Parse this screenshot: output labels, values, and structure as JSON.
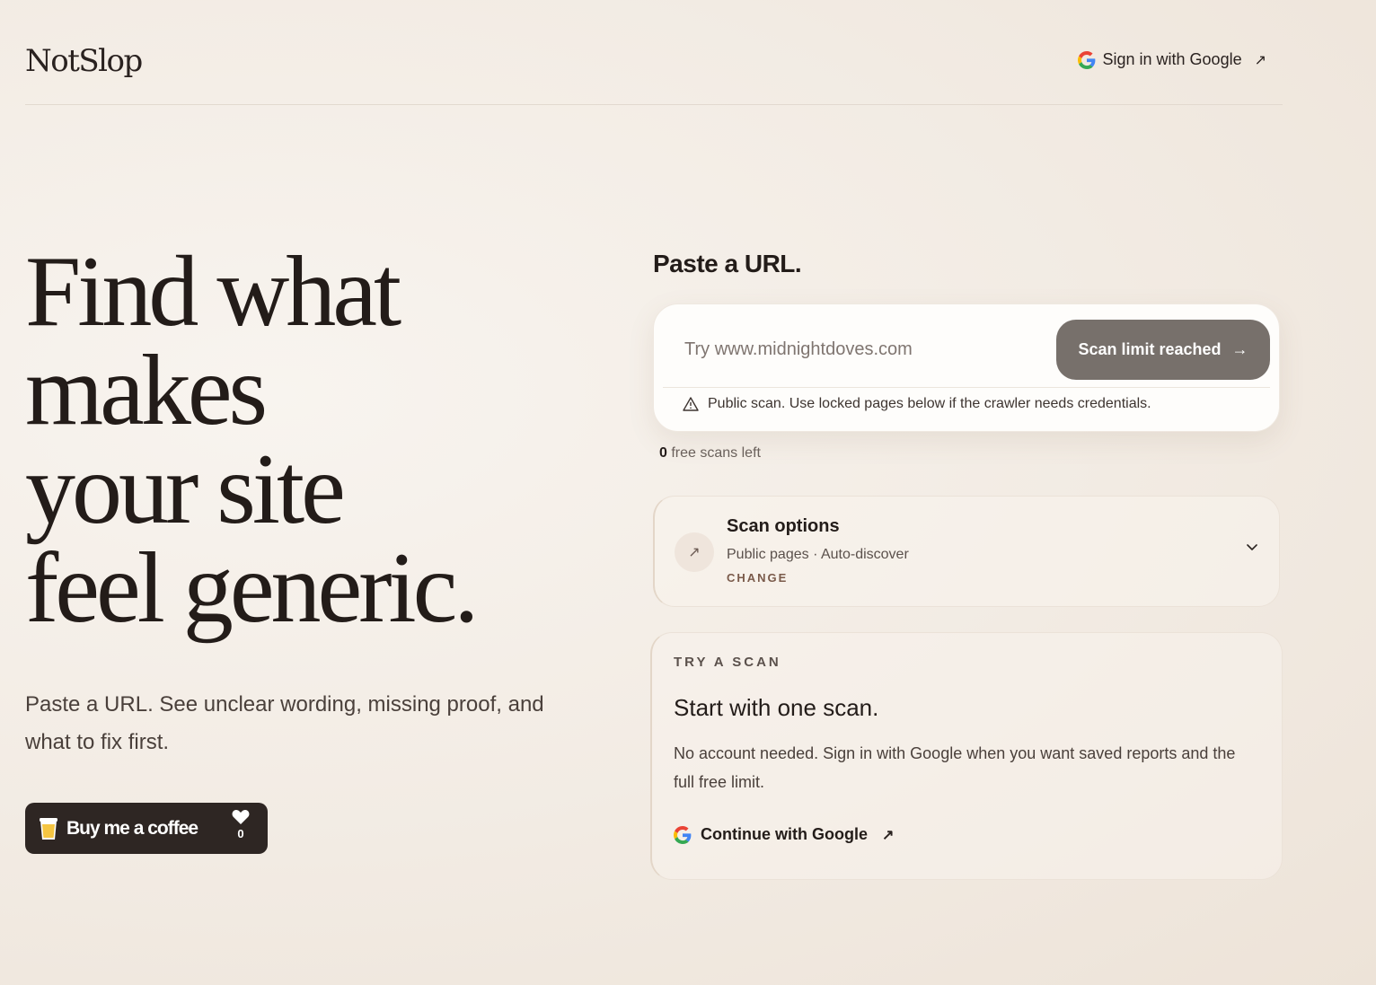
{
  "header": {
    "logo": "NotSlop",
    "signin_label": "Sign in with Google"
  },
  "hero": {
    "title_line1": "Find what",
    "title_line2": "makes",
    "title_line3": "your site",
    "title_line4": "feel generic.",
    "subtitle": "Paste a URL. See unclear wording, missing proof, and what to fix first."
  },
  "coffee": {
    "label": "Buy me a coffee",
    "count": "0"
  },
  "scan": {
    "title": "Paste a URL.",
    "placeholder": "Try www.midnightdoves.com",
    "button_label": "Scan limit reached",
    "note": "Public scan. Use locked pages below if the crawler needs credentials.",
    "free_count": "0",
    "free_label": "free scans left"
  },
  "options": {
    "title": "Scan options",
    "summary": "Public pages · Auto-discover",
    "change_label": "CHANGE"
  },
  "try": {
    "eyebrow": "TRY A SCAN",
    "title": "Start with one scan.",
    "body": "No account needed. Sign in with Google when you want saved reports and the full free limit.",
    "google_label": "Continue with Google"
  },
  "colors": {
    "accent_dark": "#2e2623",
    "button_muted": "#77706b",
    "change_accent": "#7a5a4a"
  }
}
